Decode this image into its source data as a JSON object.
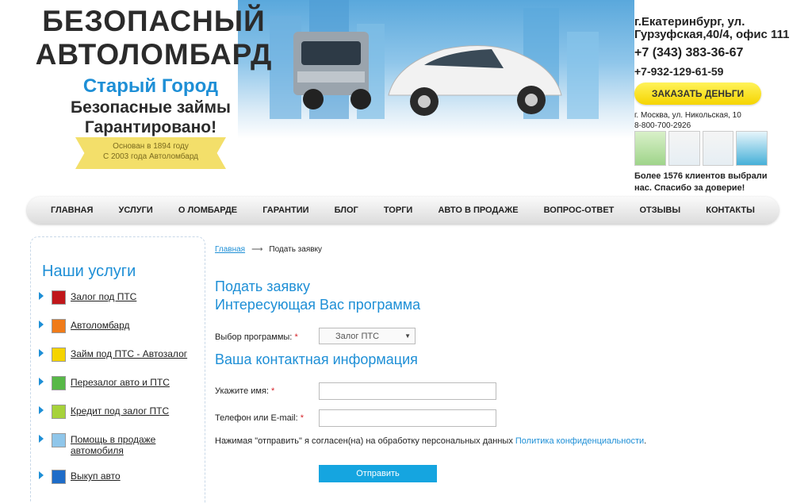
{
  "header": {
    "brand_title": "БЕЗОПАСНЫЙ АВТОЛОМБАРД",
    "brand_sub1": "Старый Город",
    "brand_sub2": "Безопасные займы Гарантировано!",
    "ribbon_line1": "Основан в 1894 году",
    "ribbon_line2": "С 2003 года Автоломбард",
    "city_address": "г.Екатеринбург, ул. Гурзуфская,40/4, офис 111",
    "phone1": "+7 (343) 383-36-67",
    "phone2": "+7-932-129-61-59",
    "order_button": "ЗАКАЗАТЬ ДЕНЬГИ",
    "moscow_address": "г. Москва, ул. Никольская, 10",
    "moscow_phone": "8-800-700-2926",
    "clients_text": "Более 1576 клиентов выбрали нас. Спасибо за доверие!"
  },
  "nav": {
    "items": [
      "ГЛАВНАЯ",
      "УСЛУГИ",
      "О ЛОМБАРДЕ",
      "ГАРАНТИИ",
      "БЛОГ",
      "ТОРГИ",
      "АВТО В ПРОДАЖЕ",
      "ВОПРОС-ОТВЕТ",
      "ОТЗЫВЫ",
      "КОНТАКТЫ"
    ]
  },
  "sidebar": {
    "title": "Наши услуги",
    "items": [
      {
        "label": "Залог под ПТС",
        "thumb_color": "#c0161a"
      },
      {
        "label": "Автоломбард",
        "thumb_color": "#f07b19"
      },
      {
        "label": "Займ под ПТС - Автозалог",
        "thumb_color": "#f5d400"
      },
      {
        "label": "Перезалог авто и ПТС",
        "thumb_color": "#57b847"
      },
      {
        "label": "Кредит под залог ПТС",
        "thumb_color": "#a6d23a"
      },
      {
        "label": "Помощь в продаже автомобиля",
        "thumb_color": "#8fc6ea"
      },
      {
        "label": "Выкуп авто",
        "thumb_color": "#1e6cc8"
      }
    ]
  },
  "breadcrumb": {
    "home": "Главная",
    "separator": "⟶",
    "current": "Подать заявку"
  },
  "form": {
    "title_line1": "Подать заявку",
    "title_line2": "Интересующая Вас программа",
    "program_label": "Выбор программы:",
    "program_value": "Залог ПТС",
    "contact_title": "Ваша контактная информация",
    "name_label": "Укажите имя:",
    "name_value": "",
    "contact_label": "Телефон или E-mail:",
    "contact_value": "",
    "required_mark": "*",
    "consent_text": "Нажимая \"отправить\" я согласен(на) на обработку персональных данных",
    "consent_link": "Политика конфиденциальности",
    "consent_end": ".",
    "submit": "Отправить"
  }
}
